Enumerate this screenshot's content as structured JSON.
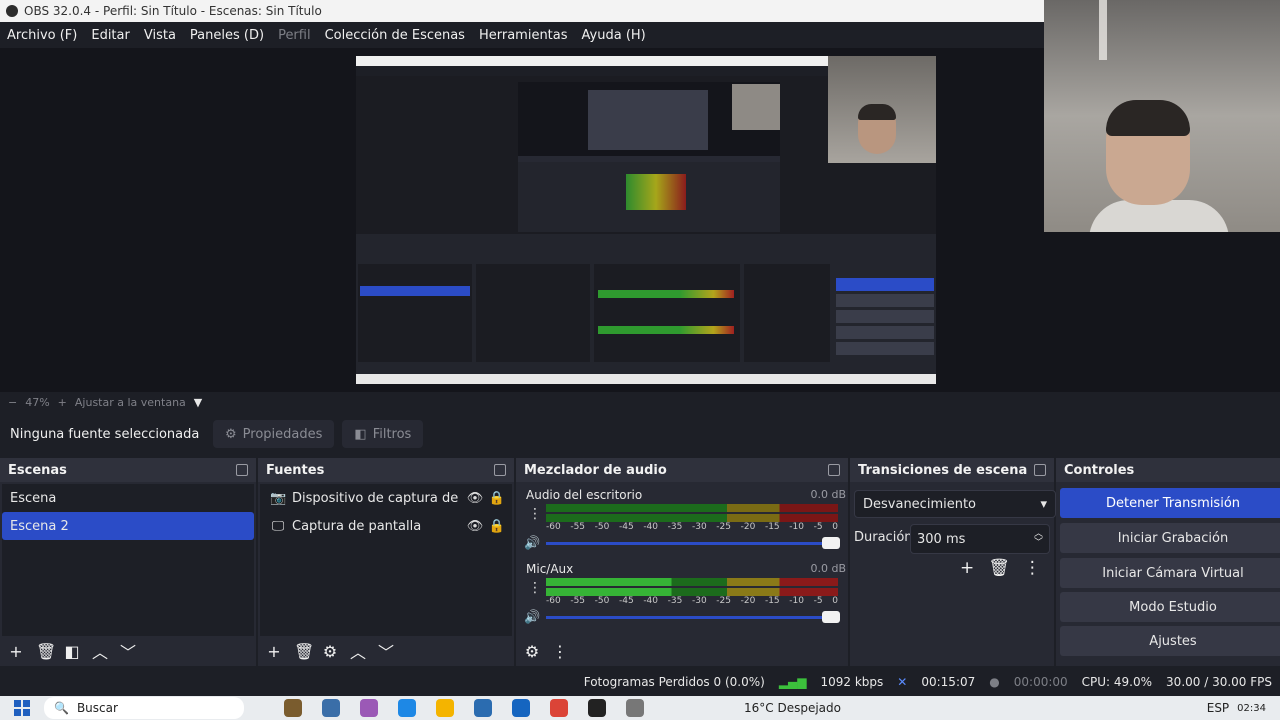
{
  "window": {
    "title": "OBS 32.0.4 - Perfil: Sin Título - Escenas: Sin Título"
  },
  "menu": [
    "Archivo (F)",
    "Editar",
    "Vista",
    "Paneles (D)",
    "Perfil",
    "Colección de Escenas",
    "Herramientas",
    "Ayuda (H)"
  ],
  "zoom": {
    "percent": "47%",
    "fit": "Ajustar a la ventana"
  },
  "source_toolbar": {
    "no_source": "Ninguna fuente seleccionada",
    "properties": "Propiedades",
    "filters": "Filtros"
  },
  "scenes": {
    "title": "Escenas",
    "items": [
      "Escena",
      "Escena 2"
    ],
    "selected_index": 1
  },
  "sources": {
    "title": "Fuentes",
    "items": [
      {
        "label": "Dispositivo de captura de vid",
        "icon": "camera-icon"
      },
      {
        "label": "Captura de pantalla",
        "icon": "monitor-icon"
      }
    ]
  },
  "mixer": {
    "title": "Mezclador de audio",
    "channels": [
      {
        "name": "Audio del escritorio",
        "db": "0.0 dB",
        "active": false
      },
      {
        "name": "Mic/Aux",
        "db": "0.0 dB",
        "active": true
      }
    ],
    "ticks": [
      "-60",
      "-55",
      "-50",
      "-45",
      "-40",
      "-35",
      "-30",
      "-25",
      "-20",
      "-15",
      "-10",
      "-5",
      "0"
    ]
  },
  "transitions": {
    "title": "Transiciones de escena",
    "selected": "Desvanecimiento",
    "duration_label": "Duración",
    "duration_value": "300 ms"
  },
  "controls": {
    "title": "Controles",
    "buttons": [
      "Detener Transmisión",
      "Iniciar Grabación",
      "Iniciar Cámara Virtual",
      "Modo Estudio",
      "Ajustes"
    ]
  },
  "status": {
    "dropped": "Fotogramas Perdidos 0 (0.0%)",
    "bitrate": "1092 kbps",
    "stream_time": "00:15:07",
    "rec_time": "00:00:00",
    "cpu": "CPU: 49.0%",
    "fps": "30.00 / 30.00 FPS"
  },
  "taskbar": {
    "search": "Buscar",
    "weather": "16°C  Despejado",
    "lang": "ESP",
    "time": "02:34"
  }
}
